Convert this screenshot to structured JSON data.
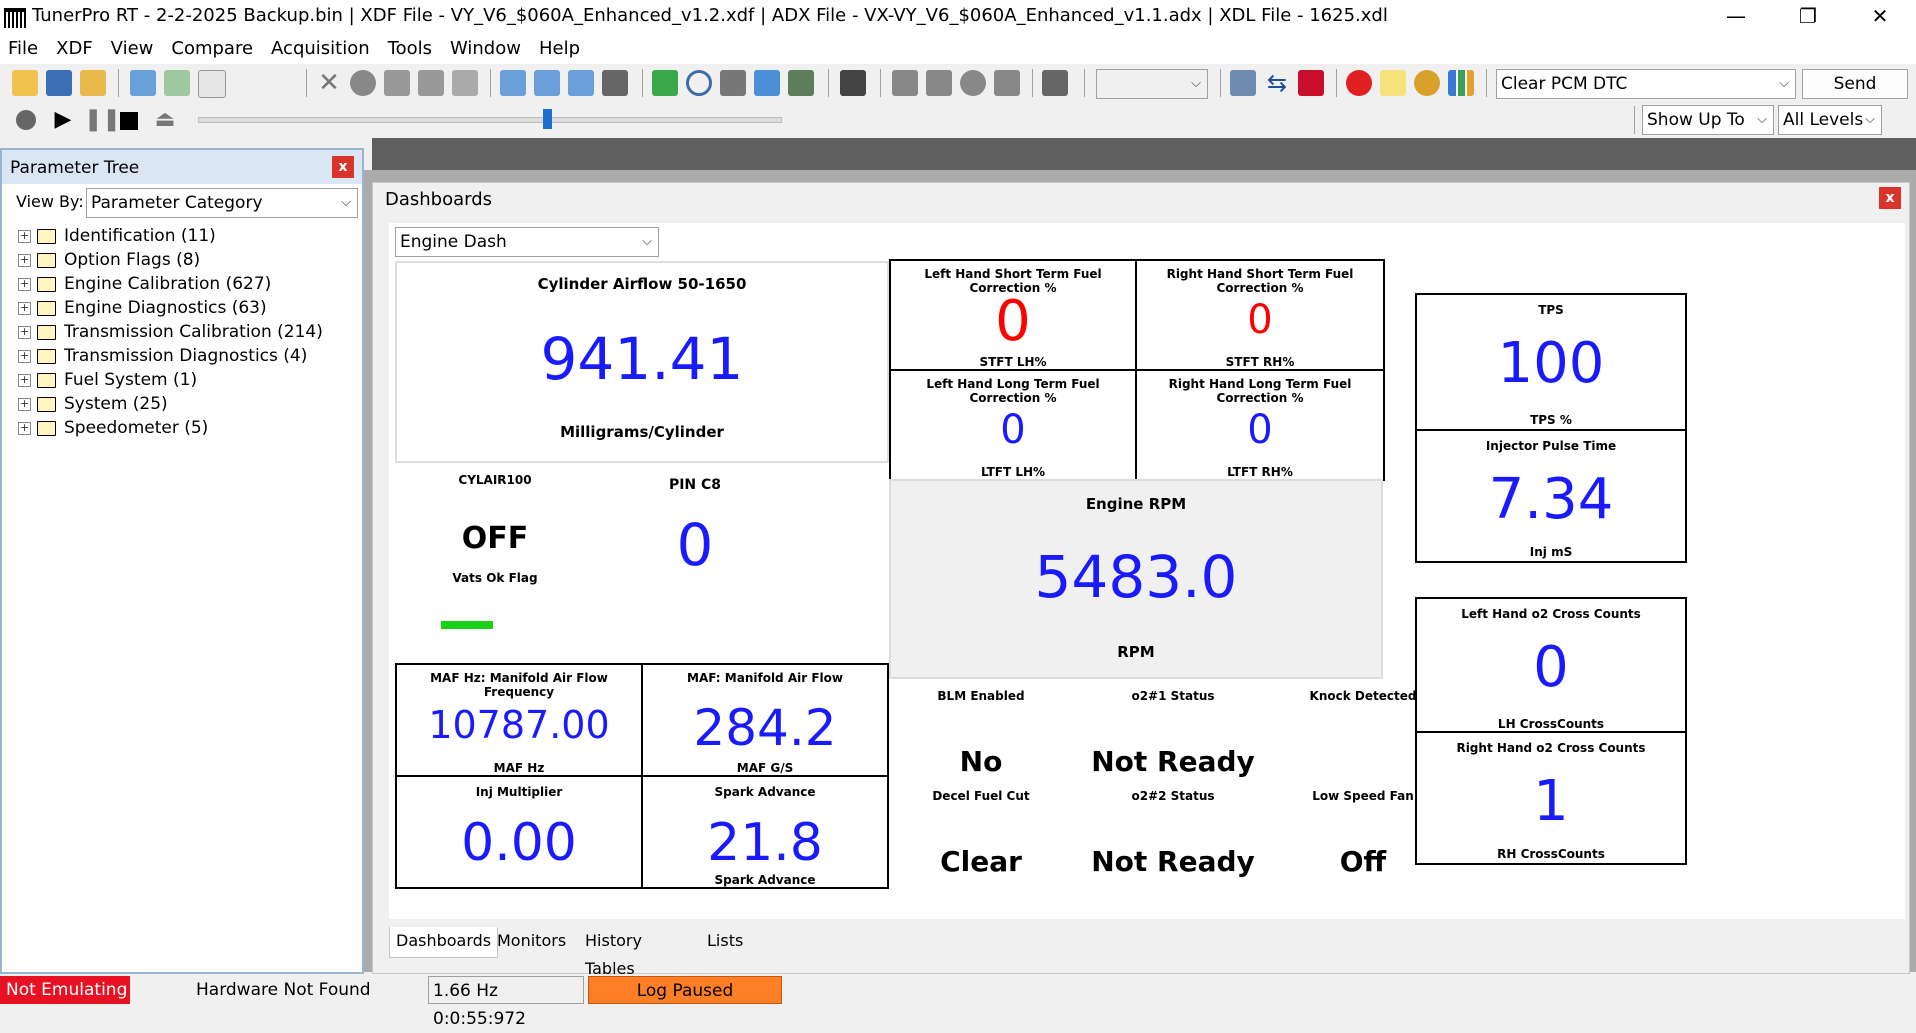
{
  "window": {
    "title": "TunerPro RT - 2-2-2025 Backup.bin | XDF File - VY_V6_$060A_Enhanced_v1.2.xdf | ADX File - VX-VY_V6_$060A_Enhanced_v1.1.adx | XDL File - 1625.xdl",
    "minimize": "—",
    "restore": "❐",
    "close": "✕"
  },
  "menu": [
    "File",
    "XDF",
    "View",
    "Compare",
    "Acquisition",
    "Tools",
    "Window",
    "Help"
  ],
  "toolbar": {
    "dtc_command": "Clear PCM DTC",
    "send_label": "Send",
    "show_up_to": "Show Up To",
    "levels": "All Levels",
    "slider_value": 0.6
  },
  "parameter_tree": {
    "title": "Parameter Tree",
    "close": "x",
    "view_by_label": "View By:",
    "view_by_value": "Parameter Category",
    "items": [
      "Identification (11)",
      "Option Flags (8)",
      "Engine Calibration (627)",
      "Engine Diagnostics (63)",
      "Transmission Calibration (214)",
      "Transmission Diagnostics (4)",
      "Fuel System (1)",
      "System (25)",
      "Speedometer (5)"
    ]
  },
  "dashboards": {
    "title": "Dashboards",
    "close": "x",
    "selected": "Engine Dash",
    "gauges": {
      "cyl_airflow": {
        "title": "Cylinder Airflow 50-1650",
        "value": "941.41",
        "unit": "Milligrams/Cylinder"
      },
      "cylair100": {
        "title": "CYLAIR100",
        "value": "OFF",
        "unit": "Vats Ok Flag"
      },
      "pin_c8": {
        "title": "PIN C8",
        "value": "0"
      },
      "stft_lh": {
        "title": "Left Hand Short Term Fuel Correction %",
        "value": "0",
        "unit": "STFT LH%"
      },
      "stft_rh": {
        "title": "Right Hand Short Term Fuel Correction %",
        "value": "0",
        "unit": "STFT RH%"
      },
      "ltft_lh": {
        "title": "Left Hand Long Term Fuel Correction %",
        "value": "0",
        "unit": "LTFT LH%"
      },
      "ltft_rh": {
        "title": "Right Hand Long Term Fuel Correction %",
        "value": "0",
        "unit": "LTFT RH%"
      },
      "tps": {
        "title": "TPS",
        "value": "100",
        "unit": "TPS %"
      },
      "inj_pulse": {
        "title": "Injector Pulse Time",
        "value": "7.34",
        "unit": "Inj mS"
      },
      "rpm": {
        "title": "Engine RPM",
        "value": "5483.0",
        "unit": "RPM"
      },
      "maf_hz": {
        "title": "MAF Hz: Manifold Air Flow Frequency",
        "value": "10787.00",
        "unit": "MAF Hz"
      },
      "maf_gs": {
        "title": "MAF: Manifold Air Flow",
        "value": "284.2",
        "unit": "MAF G/S"
      },
      "inj_mult": {
        "title": "Inj Multiplier",
        "value": "0.00"
      },
      "spark": {
        "title": "Spark Advance",
        "value": "21.8",
        "unit": "Spark Advance"
      },
      "lh_o2": {
        "title": "Left Hand o2 Cross Counts",
        "value": "0",
        "unit": "LH CrossCounts"
      },
      "rh_o2": {
        "title": "Right Hand o2 Cross Counts",
        "value": "1",
        "unit": "RH CrossCounts"
      },
      "blm": {
        "title": "BLM Enabled",
        "value": "No"
      },
      "o2_1": {
        "title": "o2#1 Status",
        "value": "Not Ready"
      },
      "knock": {
        "title": "Knock Detected",
        "value": ""
      },
      "decel": {
        "title": "Decel Fuel Cut",
        "value": "Clear"
      },
      "o2_2": {
        "title": "o2#2 Status",
        "value": "Not Ready"
      },
      "fan": {
        "title": "Low Speed Fan",
        "value": "Off"
      }
    },
    "tabs": [
      "Dashboards",
      "Monitors",
      "History Tables",
      "Lists"
    ]
  },
  "status": {
    "emulation": "Not Emulating",
    "hardware": "Hardware Not Found",
    "rate": "1.66 Hz  0:0:55:972",
    "log": "Log Paused"
  },
  "colors": {
    "value_blue": "#1a1aff",
    "value_red": "#ff0000",
    "status_red": "#e81123",
    "status_orange": "#ff7f27"
  }
}
